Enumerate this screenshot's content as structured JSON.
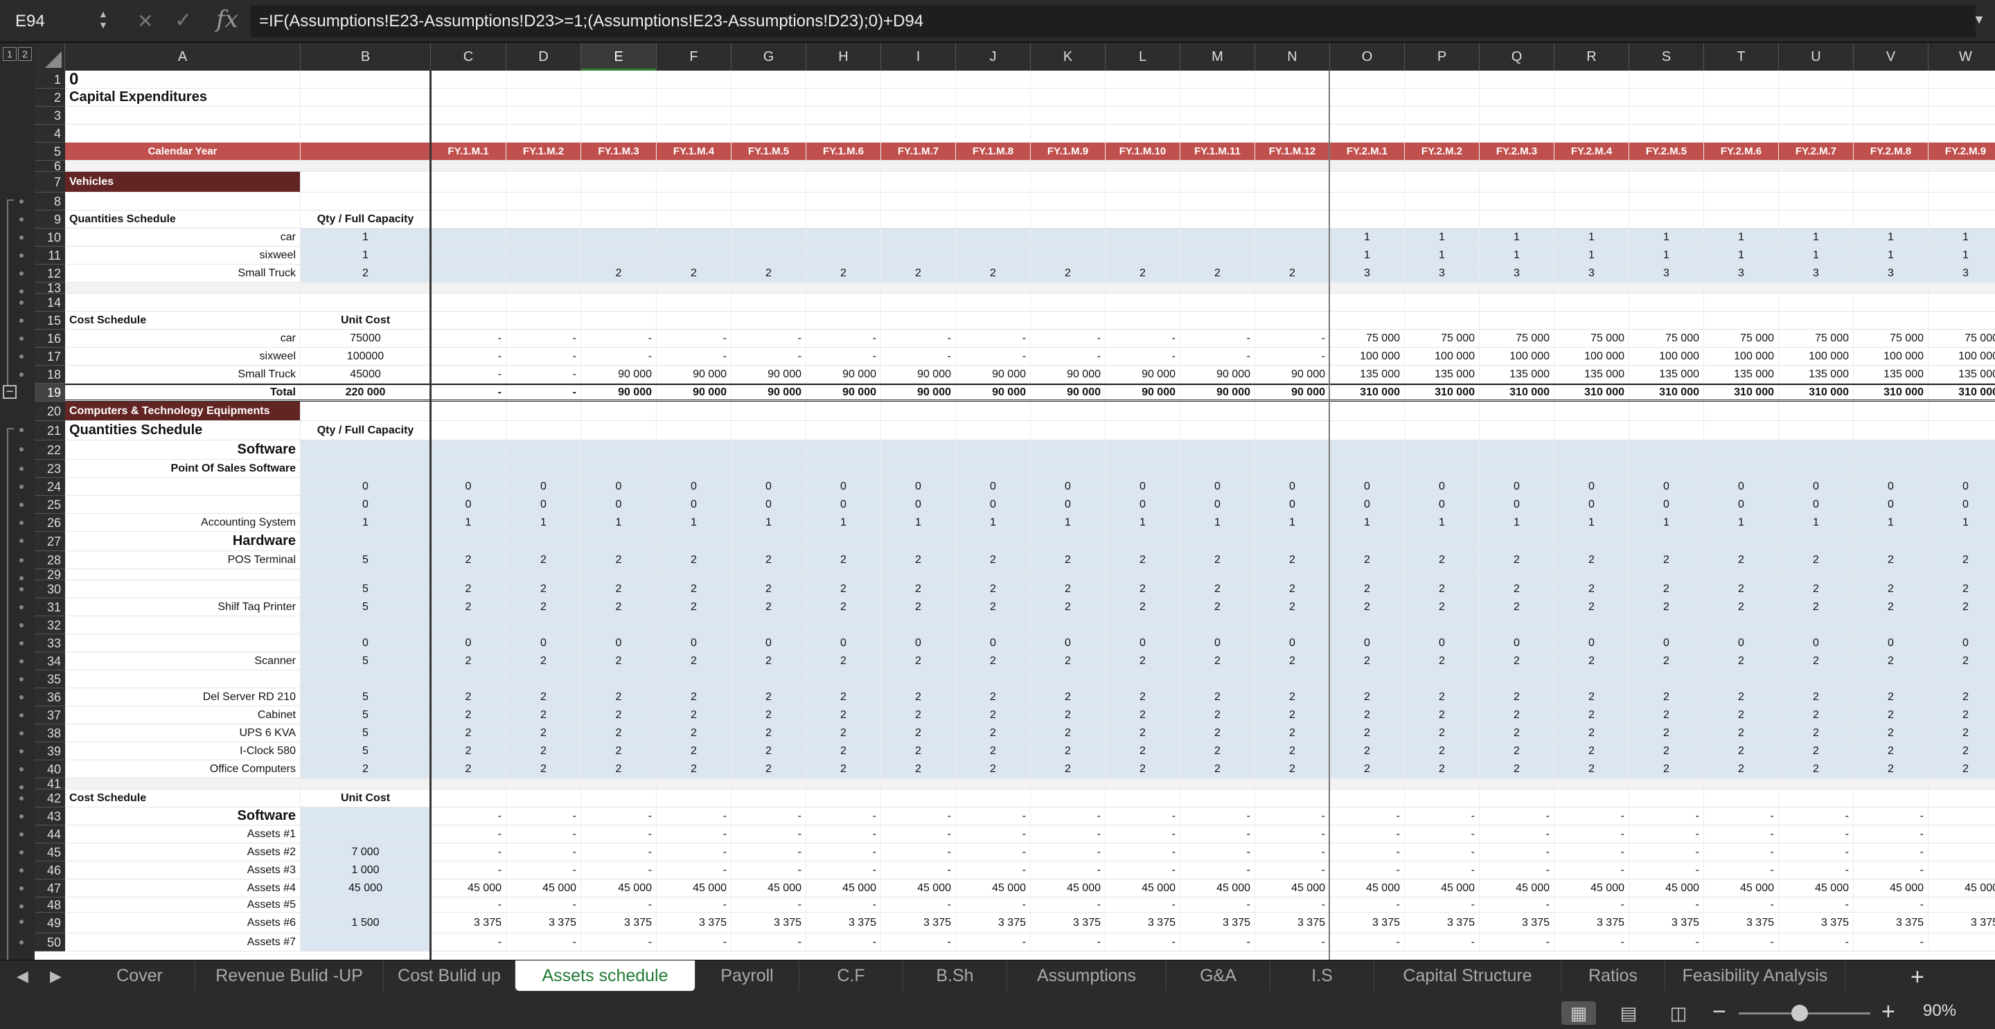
{
  "formula_bar": {
    "cell_ref": "E94",
    "formula": "=IF(Assumptions!E23-Assumptions!D23>=1;(Assumptions!E23-Assumptions!D23);0)+D94",
    "fx": "fx"
  },
  "columns": [
    "A",
    "B",
    "C",
    "D",
    "E",
    "F",
    "G",
    "H",
    "I",
    "J",
    "K",
    "L",
    "M",
    "N",
    "O",
    "P",
    "Q",
    "R",
    "S",
    "T",
    "U",
    "V",
    "W"
  ],
  "selected_column": "E",
  "outline_levels": [
    "1",
    "2"
  ],
  "rows": [
    {
      "n": "1",
      "h": 26,
      "cells": {
        "A": "0"
      },
      "style": {
        "A": "huge bold"
      }
    },
    {
      "n": "2",
      "h": 26,
      "cells": {
        "A": "Capital Expenditures"
      },
      "style": {
        "A": "big bold"
      }
    },
    {
      "n": "3",
      "h": 26,
      "cells": {}
    },
    {
      "n": "4",
      "h": 26,
      "cells": {}
    },
    {
      "n": "5",
      "h": 26,
      "kind": "header",
      "cells": {
        "A": "Calendar Year",
        "C": "FY.1.M.1",
        "D": "FY.1.M.2",
        "E": "FY.1.M.3",
        "F": "FY.1.M.4",
        "G": "FY.1.M.5",
        "H": "FY.1.M.6",
        "I": "FY.1.M.7",
        "J": "FY.1.M.8",
        "K": "FY.1.M.9",
        "L": "FY.1.M.10",
        "M": "FY.1.M.11",
        "N": "FY.1.M.12",
        "O": "FY.2.M.1",
        "P": "FY.2.M.2",
        "Q": "FY.2.M.3",
        "R": "FY.2.M.4",
        "S": "FY.2.M.5",
        "T": "FY.2.M.6",
        "U": "FY.2.M.7",
        "V": "FY.2.M.8",
        "W": "FY.2.M.9"
      }
    },
    {
      "n": "6",
      "h": 16,
      "kind": "gray",
      "cells": {}
    },
    {
      "n": "7",
      "h": 30,
      "kind": "section",
      "cells": {
        "A": "Vehicles"
      }
    },
    {
      "n": "8",
      "h": 26,
      "cells": {}
    },
    {
      "n": "9",
      "h": 26,
      "cells": {
        "A": "Quantities Schedule",
        "B": "Qty / Full Capacity"
      },
      "style": {
        "A": "bold",
        "B": "bold ctr"
      }
    },
    {
      "n": "10",
      "h": 26,
      "kind": "blue",
      "cells": {
        "A": "car",
        "B": "1",
        "O": "1",
        "P": "1",
        "Q": "1",
        "R": "1",
        "S": "1",
        "T": "1",
        "U": "1",
        "V": "1",
        "W": "1"
      },
      "style": {
        "A": "r"
      }
    },
    {
      "n": "11",
      "h": 26,
      "kind": "blue",
      "cells": {
        "A": "sixweel",
        "B": "1",
        "O": "1",
        "P": "1",
        "Q": "1",
        "R": "1",
        "S": "1",
        "T": "1",
        "U": "1",
        "V": "1",
        "W": "1"
      },
      "style": {
        "A": "r"
      }
    },
    {
      "n": "12",
      "h": 26,
      "kind": "blue",
      "cells": {
        "A": "Small Truck",
        "B": "2",
        "E": "2",
        "F": "2",
        "G": "2",
        "H": "2",
        "I": "2",
        "J": "2",
        "K": "2",
        "L": "2",
        "M": "2",
        "N": "2",
        "O": "3",
        "P": "3",
        "Q": "3",
        "R": "3",
        "S": "3",
        "T": "3",
        "U": "3",
        "V": "3",
        "W": "3"
      },
      "style": {
        "A": "r"
      }
    },
    {
      "n": "13",
      "h": 16,
      "kind": "gray",
      "cells": {}
    },
    {
      "n": "14",
      "h": 26,
      "cells": {}
    },
    {
      "n": "15",
      "h": 26,
      "cells": {
        "A": "Cost Schedule",
        "B": "Unit Cost"
      },
      "style": {
        "A": "bold",
        "B": "bold ctr"
      }
    },
    {
      "n": "16",
      "h": 26,
      "cells": {
        "A": "car",
        "B": "75000",
        "C": "-",
        "D": "-",
        "E": "-",
        "F": "-",
        "G": "-",
        "H": "-",
        "I": "-",
        "J": "-",
        "K": "-",
        "L": "-",
        "M": "-",
        "N": "-",
        "O": "75 000",
        "P": "75 000",
        "Q": "75 000",
        "R": "75 000",
        "S": "75 000",
        "T": "75 000",
        "U": "75 000",
        "V": "75 000",
        "W": "75 000"
      },
      "style": {
        "A": "r"
      }
    },
    {
      "n": "17",
      "h": 26,
      "cells": {
        "A": "sixweel",
        "B": "100000",
        "C": "-",
        "D": "-",
        "E": "-",
        "F": "-",
        "G": "-",
        "H": "-",
        "I": "-",
        "J": "-",
        "K": "-",
        "L": "-",
        "M": "-",
        "N": "-",
        "O": "100 000",
        "P": "100 000",
        "Q": "100 000",
        "R": "100 000",
        "S": "100 000",
        "T": "100 000",
        "U": "100 000",
        "V": "100 000",
        "W": "100 000"
      },
      "style": {
        "A": "r"
      }
    },
    {
      "n": "18",
      "h": 26,
      "cells": {
        "A": "Small Truck",
        "B": "45000",
        "C": "-",
        "D": "-",
        "E": "90 000",
        "F": "90 000",
        "G": "90 000",
        "H": "90 000",
        "I": "90 000",
        "J": "90 000",
        "K": "90 000",
        "L": "90 000",
        "M": "90 000",
        "N": "90 000",
        "O": "135 000",
        "P": "135 000",
        "Q": "135 000",
        "R": "135 000",
        "S": "135 000",
        "T": "135 000",
        "U": "135 000",
        "V": "135 000",
        "W": "135 000"
      },
      "style": {
        "A": "r"
      }
    },
    {
      "n": "19",
      "h": 26,
      "kind": "total",
      "cells": {
        "A": "Total",
        "B": "220 000",
        "C": "-",
        "D": "-",
        "E": "90 000",
        "F": "90 000",
        "G": "90 000",
        "H": "90 000",
        "I": "90 000",
        "J": "90 000",
        "K": "90 000",
        "L": "90 000",
        "M": "90 000",
        "N": "90 000",
        "O": "310 000",
        "P": "310 000",
        "Q": "310 000",
        "R": "310 000",
        "S": "310 000",
        "T": "310 000",
        "U": "310 000",
        "V": "310 000",
        "W": "310 000"
      },
      "style": {
        "A": "r"
      }
    },
    {
      "n": "20",
      "h": 28,
      "kind": "section",
      "cells": {
        "A": "Computers & Technology Equipments"
      }
    },
    {
      "n": "21",
      "h": 28,
      "cells": {
        "A": "Quantities Schedule",
        "B": "Qty / Full Capacity"
      },
      "style": {
        "A": "big bold",
        "B": "bold ctr"
      }
    },
    {
      "n": "22",
      "h": 28,
      "kind": "blue",
      "cells": {
        "A": "Software"
      },
      "style": {
        "A": "r big bold"
      }
    },
    {
      "n": "23",
      "h": 26,
      "kind": "blue",
      "cells": {
        "A": "Point Of Sales  Software"
      },
      "style": {
        "A": "r bold"
      }
    },
    {
      "n": "24",
      "h": 26,
      "kind": "blue",
      "cells": {
        "B": "0",
        "C": "0",
        "D": "0",
        "E": "0",
        "F": "0",
        "G": "0",
        "H": "0",
        "I": "0",
        "J": "0",
        "K": "0",
        "L": "0",
        "M": "0",
        "N": "0",
        "O": "0",
        "P": "0",
        "Q": "0",
        "R": "0",
        "S": "0",
        "T": "0",
        "U": "0",
        "V": "0",
        "W": "0"
      }
    },
    {
      "n": "25",
      "h": 26,
      "kind": "blue",
      "cells": {
        "B": "0",
        "C": "0",
        "D": "0",
        "E": "0",
        "F": "0",
        "G": "0",
        "H": "0",
        "I": "0",
        "J": "0",
        "K": "0",
        "L": "0",
        "M": "0",
        "N": "0",
        "O": "0",
        "P": "0",
        "Q": "0",
        "R": "0",
        "S": "0",
        "T": "0",
        "U": "0",
        "V": "0",
        "W": "0"
      }
    },
    {
      "n": "26",
      "h": 26,
      "kind": "blue",
      "cells": {
        "A": "Accounting System",
        "B": "1",
        "C": "1",
        "D": "1",
        "E": "1",
        "F": "1",
        "G": "1",
        "H": "1",
        "I": "1",
        "J": "1",
        "K": "1",
        "L": "1",
        "M": "1",
        "N": "1",
        "O": "1",
        "P": "1",
        "Q": "1",
        "R": "1",
        "S": "1",
        "T": "1",
        "U": "1",
        "V": "1",
        "W": "1"
      },
      "style": {
        "A": "r"
      }
    },
    {
      "n": "27",
      "h": 28,
      "kind": "blue",
      "cells": {
        "A": "Hardware"
      },
      "style": {
        "A": "r big bold"
      }
    },
    {
      "n": "28",
      "h": 26,
      "kind": "blue",
      "cells": {
        "A": "POS Terminal",
        "B": "5",
        "C": "2",
        "D": "2",
        "E": "2",
        "F": "2",
        "G": "2",
        "H": "2",
        "I": "2",
        "J": "2",
        "K": "2",
        "L": "2",
        "M": "2",
        "N": "2",
        "O": "2",
        "P": "2",
        "Q": "2",
        "R": "2",
        "S": "2",
        "T": "2",
        "U": "2",
        "V": "2",
        "W": "2"
      },
      "style": {
        "A": "r"
      }
    },
    {
      "n": "29",
      "h": 16,
      "kind": "blue",
      "cells": {}
    },
    {
      "n": "30",
      "h": 26,
      "kind": "blue",
      "cells": {
        "B": "5",
        "C": "2",
        "D": "2",
        "E": "2",
        "F": "2",
        "G": "2",
        "H": "2",
        "I": "2",
        "J": "2",
        "K": "2",
        "L": "2",
        "M": "2",
        "N": "2",
        "O": "2",
        "P": "2",
        "Q": "2",
        "R": "2",
        "S": "2",
        "T": "2",
        "U": "2",
        "V": "2",
        "W": "2"
      }
    },
    {
      "n": "31",
      "h": 26,
      "kind": "blue",
      "cells": {
        "A": "Shilf Taq  Printer",
        "B": "5",
        "C": "2",
        "D": "2",
        "E": "2",
        "F": "2",
        "G": "2",
        "H": "2",
        "I": "2",
        "J": "2",
        "K": "2",
        "L": "2",
        "M": "2",
        "N": "2",
        "O": "2",
        "P": "2",
        "Q": "2",
        "R": "2",
        "S": "2",
        "T": "2",
        "U": "2",
        "V": "2",
        "W": "2"
      },
      "style": {
        "A": "r"
      }
    },
    {
      "n": "32",
      "h": 26,
      "kind": "blue",
      "cells": {}
    },
    {
      "n": "33",
      "h": 26,
      "kind": "blue",
      "cells": {
        "B": "0",
        "C": "0",
        "D": "0",
        "E": "0",
        "F": "0",
        "G": "0",
        "H": "0",
        "I": "0",
        "J": "0",
        "K": "0",
        "L": "0",
        "M": "0",
        "N": "0",
        "O": "0",
        "P": "0",
        "Q": "0",
        "R": "0",
        "S": "0",
        "T": "0",
        "U": "0",
        "V": "0",
        "W": "0"
      }
    },
    {
      "n": "34",
      "h": 26,
      "kind": "blue",
      "cells": {
        "A": "Scanner",
        "B": "5",
        "C": "2",
        "D": "2",
        "E": "2",
        "F": "2",
        "G": "2",
        "H": "2",
        "I": "2",
        "J": "2",
        "K": "2",
        "L": "2",
        "M": "2",
        "N": "2",
        "O": "2",
        "P": "2",
        "Q": "2",
        "R": "2",
        "S": "2",
        "T": "2",
        "U": "2",
        "V": "2",
        "W": "2"
      },
      "style": {
        "A": "r"
      }
    },
    {
      "n": "35",
      "h": 26,
      "kind": "blue",
      "cells": {}
    },
    {
      "n": "36",
      "h": 26,
      "kind": "blue",
      "cells": {
        "A": "Del Server RD 210",
        "B": "5",
        "C": "2",
        "D": "2",
        "E": "2",
        "F": "2",
        "G": "2",
        "H": "2",
        "I": "2",
        "J": "2",
        "K": "2",
        "L": "2",
        "M": "2",
        "N": "2",
        "O": "2",
        "P": "2",
        "Q": "2",
        "R": "2",
        "S": "2",
        "T": "2",
        "U": "2",
        "V": "2",
        "W": "2"
      },
      "style": {
        "A": "r"
      }
    },
    {
      "n": "37",
      "h": 26,
      "kind": "blue",
      "cells": {
        "A": "Cabinet",
        "B": "5",
        "C": "2",
        "D": "2",
        "E": "2",
        "F": "2",
        "G": "2",
        "H": "2",
        "I": "2",
        "J": "2",
        "K": "2",
        "L": "2",
        "M": "2",
        "N": "2",
        "O": "2",
        "P": "2",
        "Q": "2",
        "R": "2",
        "S": "2",
        "T": "2",
        "U": "2",
        "V": "2",
        "W": "2"
      },
      "style": {
        "A": "r"
      }
    },
    {
      "n": "38",
      "h": 26,
      "kind": "blue",
      "cells": {
        "A": "UPS 6 KVA",
        "B": "5",
        "C": "2",
        "D": "2",
        "E": "2",
        "F": "2",
        "G": "2",
        "H": "2",
        "I": "2",
        "J": "2",
        "K": "2",
        "L": "2",
        "M": "2",
        "N": "2",
        "O": "2",
        "P": "2",
        "Q": "2",
        "R": "2",
        "S": "2",
        "T": "2",
        "U": "2",
        "V": "2",
        "W": "2"
      },
      "style": {
        "A": "r"
      }
    },
    {
      "n": "39",
      "h": 26,
      "kind": "blue",
      "cells": {
        "A": "I-Clock 580",
        "B": "5",
        "C": "2",
        "D": "2",
        "E": "2",
        "F": "2",
        "G": "2",
        "H": "2",
        "I": "2",
        "J": "2",
        "K": "2",
        "L": "2",
        "M": "2",
        "N": "2",
        "O": "2",
        "P": "2",
        "Q": "2",
        "R": "2",
        "S": "2",
        "T": "2",
        "U": "2",
        "V": "2",
        "W": "2"
      },
      "style": {
        "A": "r"
      }
    },
    {
      "n": "40",
      "h": 26,
      "kind": "blue",
      "cells": {
        "A": "Office Computers",
        "B": "2",
        "C": "2",
        "D": "2",
        "E": "2",
        "F": "2",
        "G": "2",
        "H": "2",
        "I": "2",
        "J": "2",
        "K": "2",
        "L": "2",
        "M": "2",
        "N": "2",
        "O": "2",
        "P": "2",
        "Q": "2",
        "R": "2",
        "S": "2",
        "T": "2",
        "U": "2",
        "V": "2",
        "W": "2"
      },
      "style": {
        "A": "r"
      }
    },
    {
      "n": "41",
      "h": 16,
      "kind": "gray",
      "cells": {}
    },
    {
      "n": "42",
      "h": 26,
      "cells": {
        "A": "Cost Schedule",
        "B": "Unit Cost"
      },
      "style": {
        "A": "bold",
        "B": "bold ctr"
      }
    },
    {
      "n": "43",
      "h": 26,
      "cells": {
        "A": "Software",
        "C": "-",
        "D": "-",
        "E": "-",
        "F": "-",
        "G": "-",
        "H": "-",
        "I": "-",
        "J": "-",
        "K": "-",
        "L": "-",
        "M": "-",
        "N": "-",
        "O": "-",
        "P": "-",
        "Q": "-",
        "R": "-",
        "S": "-",
        "T": "-",
        "U": "-",
        "V": "-",
        "W": "-"
      },
      "style": {
        "A": "r big bold",
        "B": "blue"
      }
    },
    {
      "n": "44",
      "h": 26,
      "cells": {
        "A": "Assets #1",
        "C": "-",
        "D": "-",
        "E": "-",
        "F": "-",
        "G": "-",
        "H": "-",
        "I": "-",
        "J": "-",
        "K": "-",
        "L": "-",
        "M": "-",
        "N": "-",
        "O": "-",
        "P": "-",
        "Q": "-",
        "R": "-",
        "S": "-",
        "T": "-",
        "U": "-",
        "V": "-",
        "W": "-"
      },
      "style": {
        "A": "r",
        "B": "blue"
      }
    },
    {
      "n": "45",
      "h": 26,
      "cells": {
        "A": "Assets #2",
        "B": "7 000",
        "C": "-",
        "D": "-",
        "E": "-",
        "F": "-",
        "G": "-",
        "H": "-",
        "I": "-",
        "J": "-",
        "K": "-",
        "L": "-",
        "M": "-",
        "N": "-",
        "O": "-",
        "P": "-",
        "Q": "-",
        "R": "-",
        "S": "-",
        "T": "-",
        "U": "-",
        "V": "-",
        "W": "-"
      },
      "style": {
        "A": "r",
        "B": "blue"
      }
    },
    {
      "n": "46",
      "h": 26,
      "cells": {
        "A": "Assets #3",
        "B": "1 000",
        "C": "-",
        "D": "-",
        "E": "-",
        "F": "-",
        "G": "-",
        "H": "-",
        "I": "-",
        "J": "-",
        "K": "-",
        "L": "-",
        "M": "-",
        "N": "-",
        "O": "-",
        "P": "-",
        "Q": "-",
        "R": "-",
        "S": "-",
        "T": "-",
        "U": "-",
        "V": "-",
        "W": "-"
      },
      "style": {
        "A": "r",
        "B": "blue"
      }
    },
    {
      "n": "47",
      "h": 26,
      "cells": {
        "A": "Assets #4",
        "B": "45 000",
        "C": "45 000",
        "D": "45 000",
        "E": "45 000",
        "F": "45 000",
        "G": "45 000",
        "H": "45 000",
        "I": "45 000",
        "J": "45 000",
        "K": "45 000",
        "L": "45 000",
        "M": "45 000",
        "N": "45 000",
        "O": "45 000",
        "P": "45 000",
        "Q": "45 000",
        "R": "45 000",
        "S": "45 000",
        "T": "45 000",
        "U": "45 000",
        "V": "45 000",
        "W": "45 000"
      },
      "style": {
        "A": "r",
        "B": "blue"
      }
    },
    {
      "n": "48",
      "h": 22,
      "cells": {
        "A": "Assets #5",
        "C": "-",
        "D": "-",
        "E": "-",
        "F": "-",
        "G": "-",
        "H": "-",
        "I": "-",
        "J": "-",
        "K": "-",
        "L": "-",
        "M": "-",
        "N": "-",
        "O": "-",
        "P": "-",
        "Q": "-",
        "R": "-",
        "S": "-",
        "T": "-",
        "U": "-",
        "V": "-",
        "W": "-"
      },
      "style": {
        "A": "r",
        "B": "blue"
      }
    },
    {
      "n": "49",
      "h": 30,
      "cells": {
        "A": "Assets #6",
        "B": "1 500",
        "C": "3 375",
        "D": "3 375",
        "E": "3 375",
        "F": "3 375",
        "G": "3 375",
        "H": "3 375",
        "I": "3 375",
        "J": "3 375",
        "K": "3 375",
        "L": "3 375",
        "M": "3 375",
        "N": "3 375",
        "O": "3 375",
        "P": "3 375",
        "Q": "3 375",
        "R": "3 375",
        "S": "3 375",
        "T": "3 375",
        "U": "3 375",
        "V": "3 375",
        "W": "3 375"
      },
      "style": {
        "A": "r",
        "B": "blue"
      }
    },
    {
      "n": "50",
      "h": 26,
      "cells": {
        "A": "Assets #7",
        "C": "-",
        "D": "-",
        "E": "-",
        "F": "-",
        "G": "-",
        "H": "-",
        "I": "-",
        "J": "-",
        "K": "-",
        "L": "-",
        "M": "-",
        "N": "-",
        "O": "-",
        "P": "-",
        "Q": "-",
        "R": "-",
        "S": "-",
        "T": "-",
        "U": "-",
        "V": "-",
        "W": "-"
      },
      "style": {
        "A": "r",
        "B": "blue"
      }
    }
  ],
  "sheet_tabs": [
    "Cover",
    "Revenue Bulid -UP",
    "Cost Bulid up",
    "Assets schedule",
    "Payroll",
    "C.F",
    "B.Sh",
    "Assumptions",
    "G&A",
    "I.S",
    "Capital Structure",
    "Ratios",
    "Feasibility Analysis"
  ],
  "active_tab": "Assets schedule",
  "status": {
    "zoom": "90%"
  },
  "colors": {
    "header_red": "#c0504d",
    "section_dark_red": "#632523",
    "input_blue": "#dce6f1",
    "active_tab_green": "#1e7b34"
  }
}
